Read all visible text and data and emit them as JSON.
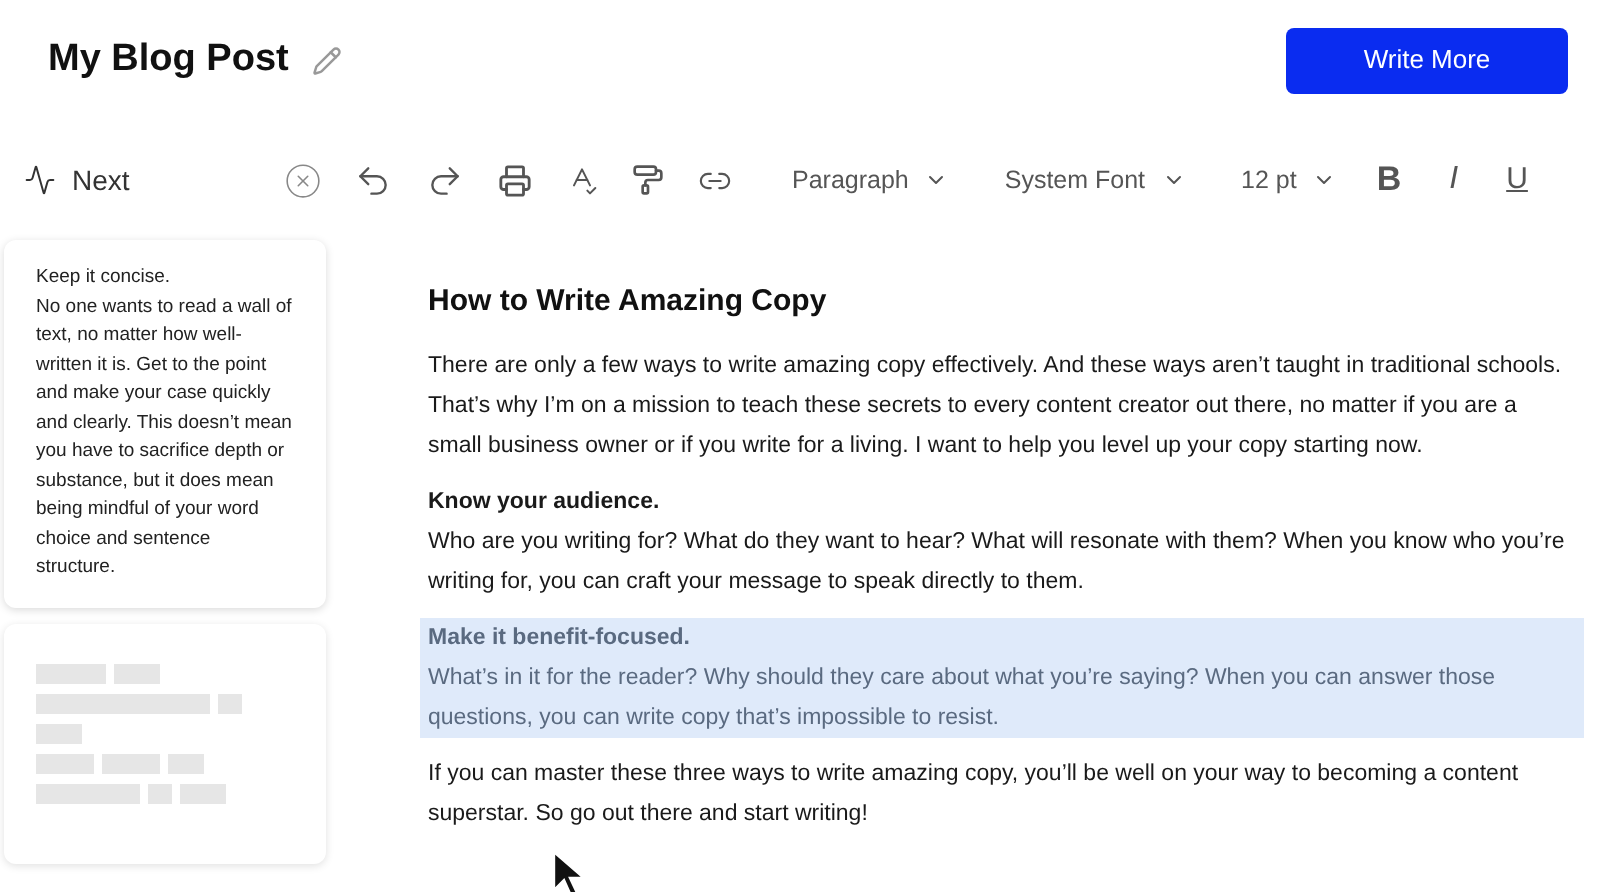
{
  "header": {
    "title": "My Blog Post",
    "action": "Write More"
  },
  "toolbar": {
    "next": "Next",
    "dropdowns": [
      {
        "label": "Paragraph"
      },
      {
        "label": "System Font"
      },
      {
        "label": "12 pt"
      }
    ],
    "format": [
      {
        "kind": "bold",
        "label": "B"
      },
      {
        "kind": "italic",
        "label": "I"
      },
      {
        "kind": "underline",
        "label": "U"
      }
    ]
  },
  "sidebar": {
    "cards": [
      {
        "kind": "tip",
        "title": "Keep it concise.",
        "body": "No one wants to read a wall of text, no matter how well-written it is. Get to the point and make your case quickly and clearly. This doesn’t mean you have to sacrifice depth or substance, but it does mean being mindful of your word choice and sentence structure."
      },
      {
        "kind": "skeleton"
      }
    ]
  },
  "document": {
    "title": "How to Write Amazing Copy",
    "paragraphs": [
      {
        "text": "There are only a few ways to write amazing copy effectively. And these ways aren’t taught in traditional schools. That’s why I’m on a mission to teach these secrets to every content creator out there, no matter if you are a small business owner or if you write for a living. I want to help you level up your copy starting now.",
        "selected": false
      },
      {
        "heading": "Know your audience.",
        "text": "Who are you writing for? What do they want to hear? What will resonate with them? When you know who you’re writing for, you can craft your message to speak directly to them.",
        "selected": false
      },
      {
        "heading": "Make it benefit-focused.",
        "text": "What’s in it for the reader? Why should they care about what you’re saying? When you can answer those questions, you can write copy that’s impossible to resist.",
        "selected": true
      },
      {
        "text": "If you can master these three ways to write amazing copy, you’ll be well on your way to becoming a content superstar. So go out there and start writing!",
        "selected": false
      }
    ]
  }
}
